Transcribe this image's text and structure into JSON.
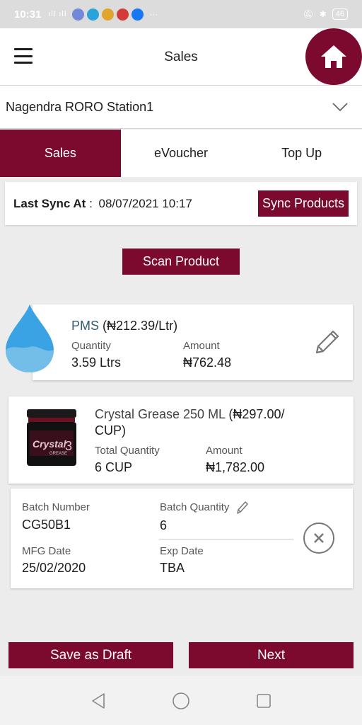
{
  "status_bar": {
    "time": "10:31",
    "signal": "·³ᴵᴵ .ᴵᴵ",
    "more": "···",
    "battery": "46"
  },
  "header": {
    "title": "Sales"
  },
  "station": {
    "selected": "Nagendra RORO Station1"
  },
  "tabs": [
    {
      "label": "Sales",
      "active": true
    },
    {
      "label": "eVoucher",
      "active": false
    },
    {
      "label": "Top Up",
      "active": false
    }
  ],
  "sync": {
    "label": "Last Sync At",
    "separator": " : ",
    "value": "08/07/2021 10:17",
    "button": "Sync Products"
  },
  "scan_button": "Scan Product",
  "products": [
    {
      "name": "PMS",
      "price": "(₦212.39/Ltr)",
      "quantity_label": "Quantity",
      "quantity": "3.59 Ltrs",
      "amount_label": "Amount",
      "amount": "₦762.48"
    },
    {
      "name": "Crystal Grease 250 ML",
      "price": "(₦297.00/",
      "price_unit": "CUP)",
      "jar_label": "Crystal",
      "jar_number": "3",
      "jar_sub": "GREASE",
      "quantity_label": "Total Quantity",
      "quantity": "6 CUP",
      "amount_label": "Amount",
      "amount": "₦1,782.00",
      "batch": {
        "batch_number_label": "Batch Number",
        "batch_number": "CG50B1",
        "batch_quantity_label": "Batch Quantity",
        "batch_quantity": "6",
        "mfg_label": "MFG Date",
        "mfg": "25/02/2020",
        "exp_label": "Exp Date",
        "exp": "TBA"
      }
    }
  ],
  "footer": {
    "draft": "Save as Draft",
    "next": "Next"
  },
  "colors": {
    "primary": "#7c0a2e",
    "accent_text": "#2f5f75",
    "drop": "#3aa3e3"
  }
}
